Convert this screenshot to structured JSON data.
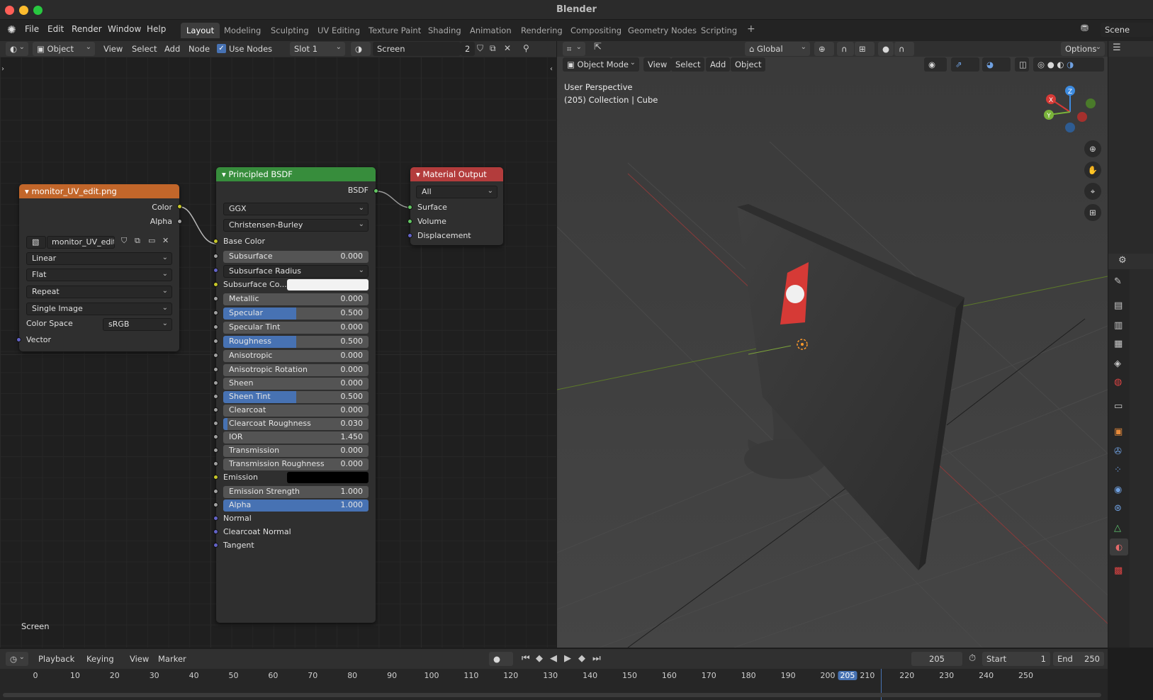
{
  "window": {
    "title": "Blender"
  },
  "menu": {
    "items": [
      "File",
      "Edit",
      "Render",
      "Window",
      "Help"
    ]
  },
  "workspaces": {
    "tabs": [
      "Layout",
      "Modeling",
      "Sculpting",
      "UV Editing",
      "Texture Paint",
      "Shading",
      "Animation",
      "Rendering",
      "Compositing",
      "Geometry Nodes",
      "Scripting"
    ],
    "active": "Layout",
    "add_label": "+"
  },
  "scene": {
    "name": "Scene"
  },
  "node_header": {
    "object_mode": "Object",
    "menus": [
      "View",
      "Select",
      "Add",
      "Node"
    ],
    "use_nodes_label": "Use Nodes",
    "use_nodes_checked": true,
    "slot": "Slot 1",
    "material_name": "Screen",
    "material_users": "2"
  },
  "node_editor": {
    "footer_label": "Screen"
  },
  "image_node": {
    "title": "monitor_UV_edit.png",
    "outputs": [
      "Color",
      "Alpha"
    ],
    "image_name": "monitor_UV_edit...",
    "interpolation": "Linear",
    "projection": "Flat",
    "extension": "Repeat",
    "source": "Single Image",
    "color_space_label": "Color Space",
    "color_space": "sRGB",
    "input": "Vector"
  },
  "bsdf_node": {
    "title": "Principled BSDF",
    "output": "BSDF",
    "distribution": "GGX",
    "subsurface_method": "Christensen-Burley",
    "base_color_label": "Base Color",
    "subsurface_radius": "Subsurface Radius",
    "subsurface_color": "Subsurface Co...",
    "fields": [
      {
        "label": "Subsurface",
        "value": "0.000",
        "fill": 0
      },
      {
        "label": "Metallic",
        "value": "0.000",
        "fill": 0
      },
      {
        "label": "Specular",
        "value": "0.500",
        "fill": 0.5
      },
      {
        "label": "Specular Tint",
        "value": "0.000",
        "fill": 0
      },
      {
        "label": "Roughness",
        "value": "0.500",
        "fill": 0.5
      },
      {
        "label": "Anisotropic",
        "value": "0.000",
        "fill": 0
      },
      {
        "label": "Anisotropic Rotation",
        "value": "0.000",
        "fill": 0
      },
      {
        "label": "Sheen",
        "value": "0.000",
        "fill": 0
      },
      {
        "label": "Sheen Tint",
        "value": "0.500",
        "fill": 0.5
      },
      {
        "label": "Clearcoat",
        "value": "0.000",
        "fill": 0
      },
      {
        "label": "Clearcoat Roughness",
        "value": "0.030",
        "fill": 0.03
      },
      {
        "label": "IOR",
        "value": "1.450",
        "fill": 0
      },
      {
        "label": "Transmission",
        "value": "0.000",
        "fill": 0
      },
      {
        "label": "Transmission Roughness",
        "value": "0.000",
        "fill": 0
      }
    ],
    "emission_label": "Emission",
    "emission_strength": {
      "label": "Emission Strength",
      "value": "1.000"
    },
    "alpha": {
      "label": "Alpha",
      "value": "1.000",
      "fill": 1
    },
    "vector_inputs": [
      "Normal",
      "Clearcoat Normal",
      "Tangent"
    ]
  },
  "output_node": {
    "title": "Material Output",
    "target": "All",
    "inputs": [
      "Surface",
      "Volume",
      "Displacement"
    ]
  },
  "viewport": {
    "transform": "Global",
    "mode": "Object Mode",
    "menus": [
      "View",
      "Select",
      "Add",
      "Object"
    ],
    "options_label": "Options",
    "overlay_line1": "User Perspective",
    "overlay_line2": "(205) Collection | Cube",
    "gizmo": {
      "x": "X",
      "y": "Y",
      "z": "Z"
    }
  },
  "timeline": {
    "menus": [
      "Playback",
      "Keying",
      "View",
      "Marker"
    ],
    "current_frame": "205",
    "start_label": "Start",
    "start": "1",
    "end_label": "End",
    "end": "250",
    "ticks": [
      "0",
      "10",
      "20",
      "30",
      "40",
      "50",
      "60",
      "70",
      "80",
      "90",
      "100",
      "110",
      "120",
      "130",
      "140",
      "150",
      "160",
      "170",
      "180",
      "190",
      "200",
      "205",
      "210",
      "220",
      "230",
      "240",
      "250"
    ]
  },
  "colors": {
    "accent": "#4772b3",
    "image_header": "#c2662a",
    "bsdf_header": "#378d3c",
    "output_header": "#b33c3c",
    "socket_color": "#c7c729",
    "socket_float": "#a1a1a1",
    "socket_vector": "#6363c7",
    "socket_shader": "#63c763"
  }
}
